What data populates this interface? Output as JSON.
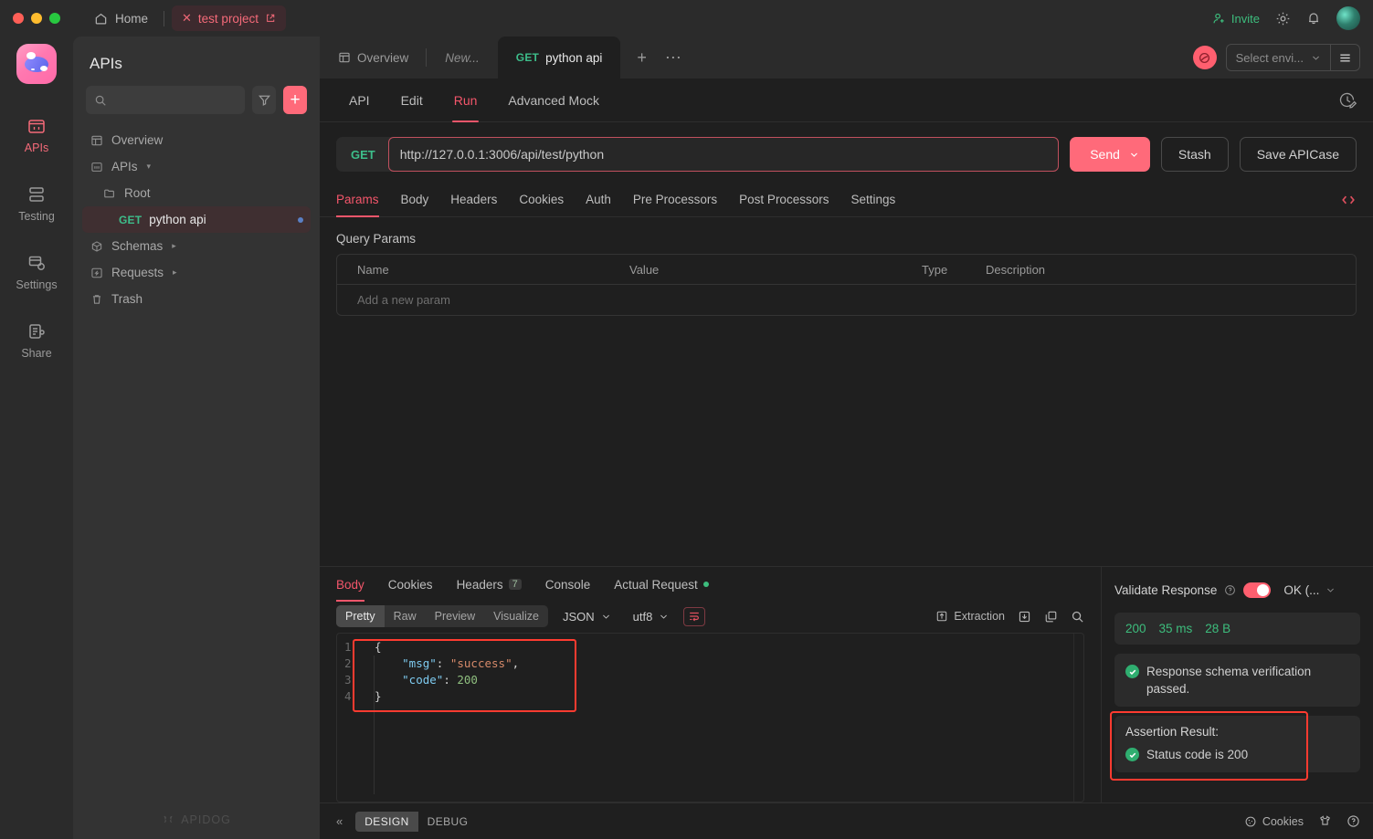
{
  "titlebar": {
    "home_label": "Home",
    "project_label": "test project",
    "invite_label": "Invite",
    "icons": [
      "home-icon",
      "close-icon",
      "external-link-icon",
      "invite-icon",
      "gear-icon",
      "bell-icon",
      "avatar"
    ]
  },
  "rail": {
    "items": [
      {
        "label": "APIs",
        "icon": "apis-icon",
        "active": true
      },
      {
        "label": "Testing",
        "icon": "testing-icon",
        "active": false
      },
      {
        "label": "Settings",
        "icon": "settings-icon",
        "active": false
      },
      {
        "label": "Share",
        "icon": "share-icon",
        "active": false
      }
    ]
  },
  "sidebar": {
    "title": "APIs",
    "search_placeholder": "",
    "search_value": "",
    "watermark": "APIDOG",
    "tree": [
      {
        "label": "Overview",
        "icon": "overview-icon",
        "level": 0,
        "caret": "",
        "method": "",
        "selected": false
      },
      {
        "label": "APIs",
        "icon": "apis-folder-icon",
        "level": 0,
        "caret": "▾",
        "method": "",
        "selected": false
      },
      {
        "label": "Root",
        "icon": "folder-icon",
        "level": 1,
        "caret": "",
        "method": "",
        "selected": false
      },
      {
        "label": "python api",
        "icon": "",
        "level": 2,
        "caret": "",
        "method": "GET",
        "selected": true
      },
      {
        "label": "Schemas",
        "icon": "schemas-icon",
        "level": 0,
        "caret": "▸",
        "method": "",
        "selected": false
      },
      {
        "label": "Requests",
        "icon": "requests-icon",
        "level": 0,
        "caret": "▸",
        "method": "",
        "selected": false
      },
      {
        "label": "Trash",
        "icon": "trash-icon",
        "level": 0,
        "caret": "",
        "method": "",
        "selected": false
      }
    ]
  },
  "tabstrip": {
    "tabs": [
      {
        "label": "Overview",
        "method": "",
        "active": false,
        "italic": false
      },
      {
        "label": "New...",
        "method": "",
        "active": false,
        "italic": true
      },
      {
        "label": "python api",
        "method": "GET",
        "active": true,
        "italic": false
      }
    ],
    "add_label": "+",
    "more_label": "⋯",
    "env_placeholder": "Select envi...",
    "env_globe_icon": "globe-icon",
    "menu_icon": "hamburger-icon"
  },
  "subnav": {
    "tabs": [
      "API",
      "Edit",
      "Run",
      "Advanced Mock"
    ],
    "active": "Run",
    "right_icon": "history-edit-icon"
  },
  "request": {
    "method": "GET",
    "url": "http://127.0.0.1:3006/api/test/python",
    "send_label": "Send",
    "stash_label": "Stash",
    "save_label": "Save APICase"
  },
  "params": {
    "tabs": [
      "Params",
      "Body",
      "Headers",
      "Cookies",
      "Auth",
      "Pre Processors",
      "Post Processors",
      "Settings"
    ],
    "active": "Params",
    "code_icon": "code-brackets-icon",
    "section_label": "Query Params",
    "columns": [
      "Name",
      "Value",
      "Type",
      "Description"
    ],
    "empty_row_placeholder": "Add a new param"
  },
  "response": {
    "tabs": [
      {
        "label": "Body",
        "badge": "",
        "dot": false,
        "active": true
      },
      {
        "label": "Cookies",
        "badge": "",
        "dot": false,
        "active": false
      },
      {
        "label": "Headers",
        "badge": "7",
        "dot": false,
        "active": false
      },
      {
        "label": "Console",
        "badge": "",
        "dot": false,
        "active": false
      },
      {
        "label": "Actual Request",
        "badge": "",
        "dot": true,
        "active": false
      }
    ],
    "view_modes": [
      "Pretty",
      "Raw",
      "Preview",
      "Visualize"
    ],
    "view_active": "Pretty",
    "format": "JSON",
    "encoding": "utf8",
    "wrap_icon": "word-wrap-icon",
    "extraction_label": "Extraction",
    "extraction_icon": "extraction-icon",
    "save_icon": "save-download-icon",
    "copy_icon": "copy-icon",
    "search_icon": "search-icon",
    "body_lines": [
      {
        "no": "1",
        "segments": [
          {
            "t": "{",
            "c": "p"
          }
        ]
      },
      {
        "no": "2",
        "segments": [
          {
            "t": "    ",
            "c": "p"
          },
          {
            "t": "\"msg\"",
            "c": "k"
          },
          {
            "t": ": ",
            "c": "p"
          },
          {
            "t": "\"success\"",
            "c": "s"
          },
          {
            "t": ",",
            "c": "p"
          }
        ]
      },
      {
        "no": "3",
        "segments": [
          {
            "t": "    ",
            "c": "p"
          },
          {
            "t": "\"code\"",
            "c": "k"
          },
          {
            "t": ": ",
            "c": "p"
          },
          {
            "t": "200",
            "c": "n"
          }
        ]
      },
      {
        "no": "4",
        "segments": [
          {
            "t": "}",
            "c": "p"
          }
        ]
      }
    ]
  },
  "validate": {
    "title": "Validate Response",
    "help_icon": "question-circle-icon",
    "toggle_on": true,
    "status_select": "OK (...",
    "status_code": "200",
    "duration": "35 ms",
    "size": "28 B",
    "schema_message": "Response schema verification passed.",
    "assertion_title": "Assertion Result:",
    "assertion_item": "Status code is 200"
  },
  "statusbar": {
    "collapse_icon": "double-chevron-left-icon",
    "modes": [
      "DESIGN",
      "DEBUG"
    ],
    "mode_active": "DESIGN",
    "cookies_label": "Cookies",
    "cookies_icon": "cookie-icon",
    "shirt_icon": "theme-shirt-icon",
    "help_icon": "help-circle-icon"
  },
  "colors": {
    "accent": "#ff6a7a",
    "accent_text": "#f4566b",
    "green": "#3dbd7d",
    "method_get": "#3dbd8a",
    "highlight_box": "#ff3b30"
  }
}
